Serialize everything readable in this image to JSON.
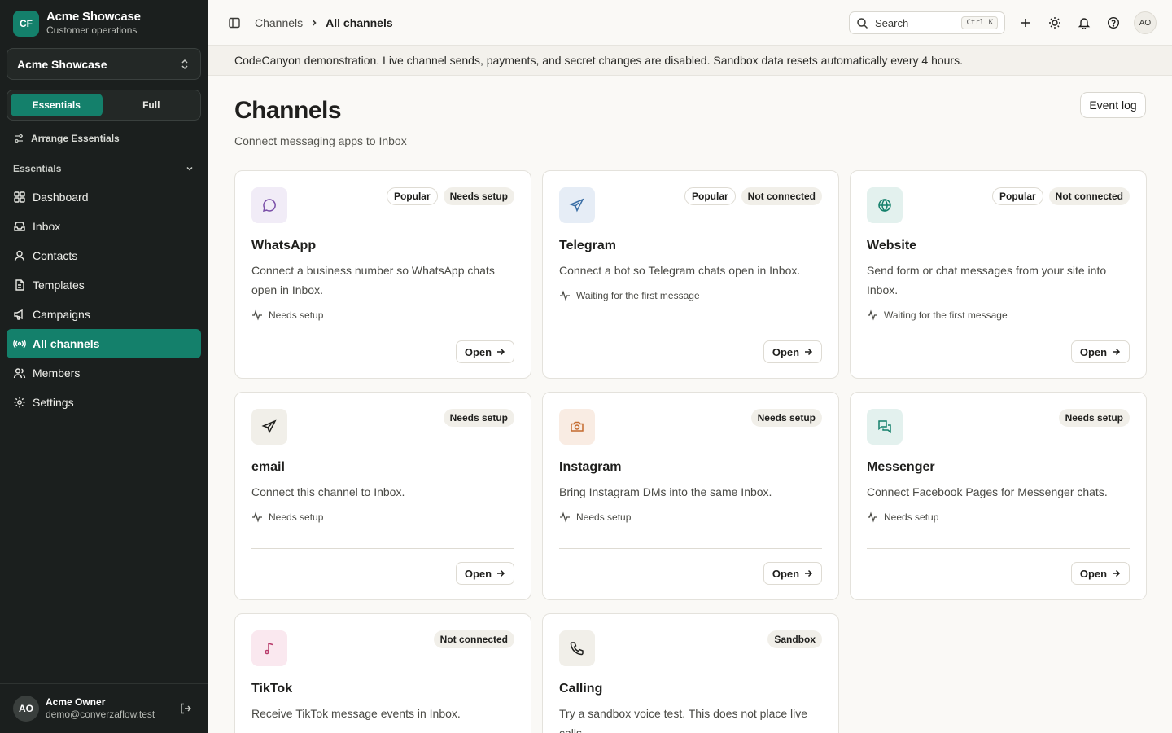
{
  "brand": {
    "logo": "CF",
    "name": "Acme Showcase",
    "subtitle": "Customer operations"
  },
  "workspace": {
    "label": "Acme Showcase"
  },
  "mode_toggle": {
    "essentials": "Essentials",
    "full": "Full"
  },
  "sidebar": {
    "arrange_label": "Arrange Essentials",
    "section_label": "Essentials",
    "items": [
      {
        "label": "Dashboard",
        "icon": "dashboard-icon"
      },
      {
        "label": "Inbox",
        "icon": "inbox-icon"
      },
      {
        "label": "Contacts",
        "icon": "contacts-icon"
      },
      {
        "label": "Templates",
        "icon": "templates-icon"
      },
      {
        "label": "Campaigns",
        "icon": "megaphone-icon"
      },
      {
        "label": "All channels",
        "icon": "broadcast-icon"
      },
      {
        "label": "Members",
        "icon": "members-icon"
      },
      {
        "label": "Settings",
        "icon": "gear-icon"
      }
    ]
  },
  "user": {
    "initials": "AO",
    "name": "Acme Owner",
    "email": "demo@converzaflow.test"
  },
  "topbar": {
    "breadcrumb_parent": "Channels",
    "breadcrumb_current": "All channels",
    "search_placeholder": "Search",
    "search_shortcut": "Ctrl K",
    "avatar_initials": "AO"
  },
  "banner": "CodeCanyon demonstration. Live channel sends, payments, and secret changes are disabled. Sandbox data resets automatically every 4 hours.",
  "page": {
    "title": "Channels",
    "subtitle": "Connect messaging apps to Inbox",
    "event_log_label": "Event log"
  },
  "colors": {
    "accent": "#14806b",
    "sidebar_bg": "#1b1f1e"
  },
  "cards": [
    {
      "name": "WhatsApp",
      "desc": "Connect a business number so WhatsApp chats open in Inbox.",
      "status": "Needs setup",
      "badges": [
        "Popular",
        "Needs setup"
      ],
      "open": "Open",
      "icon": "chat-bubble-icon"
    },
    {
      "name": "Telegram",
      "desc": "Connect a bot so Telegram chats open in Inbox.",
      "status": "Waiting for the first message",
      "badges": [
        "Popular",
        "Not connected"
      ],
      "open": "Open",
      "icon": "send-icon"
    },
    {
      "name": "Website",
      "desc": "Send form or chat messages from your site into Inbox.",
      "status": "Waiting for the first message",
      "badges": [
        "Popular",
        "Not connected"
      ],
      "open": "Open",
      "icon": "globe-icon"
    },
    {
      "name": "email",
      "desc": "Connect this channel to Inbox.",
      "status": "Needs setup",
      "badges": [
        "Needs setup"
      ],
      "open": "Open",
      "icon": "paper-plane-icon"
    },
    {
      "name": "Instagram",
      "desc": "Bring Instagram DMs into the same Inbox.",
      "status": "Needs setup",
      "badges": [
        "Needs setup"
      ],
      "open": "Open",
      "icon": "camera-icon"
    },
    {
      "name": "Messenger",
      "desc": "Connect Facebook Pages for Messenger chats.",
      "status": "Needs setup",
      "badges": [
        "Needs setup"
      ],
      "open": "Open",
      "icon": "messages-icon"
    },
    {
      "name": "TikTok",
      "desc": "Receive TikTok message events in Inbox.",
      "badges": [
        "Not connected"
      ],
      "icon": "music-note-icon"
    },
    {
      "name": "Calling",
      "desc": "Try a sandbox voice test. This does not place live calls.",
      "badges": [
        "Sandbox"
      ],
      "icon": "phone-icon"
    }
  ]
}
